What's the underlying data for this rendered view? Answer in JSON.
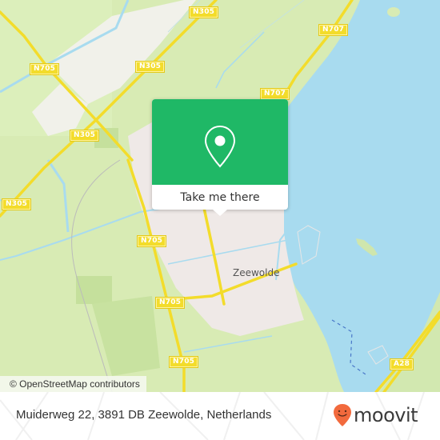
{
  "map": {
    "road_labels": [
      {
        "id": "n305-top",
        "text": "N305"
      },
      {
        "id": "n707-top",
        "text": "N707"
      },
      {
        "id": "n705-left",
        "text": "N705"
      },
      {
        "id": "n305-mid",
        "text": "N305"
      },
      {
        "id": "n707-mid",
        "text": "N707"
      },
      {
        "id": "n305-lower",
        "text": "N305"
      },
      {
        "id": "n305-left",
        "text": "N305"
      },
      {
        "id": "n705-mid",
        "text": "N705"
      },
      {
        "id": "n705-low",
        "text": "N705"
      },
      {
        "id": "n705-bottom",
        "text": "N705"
      },
      {
        "id": "a28",
        "text": "A28"
      }
    ],
    "city_label": "Zeewolde",
    "attribution": "© OpenStreetMap contributors",
    "colors": {
      "land": "#d8ebb4",
      "water": "#a8dbef",
      "urban": "#efe9e7",
      "road": "#f3dc2b",
      "popup_green": "#1fb866"
    }
  },
  "popup": {
    "icon": "location-pin-icon",
    "button_label": "Take me there"
  },
  "footer": {
    "address": "Muiderweg 22, 3891 DB Zeewolde, Netherlands",
    "logo_text": "moovit",
    "logo_icon": "moovit-smile-pin-icon",
    "logo_color": "#f26a3d"
  }
}
